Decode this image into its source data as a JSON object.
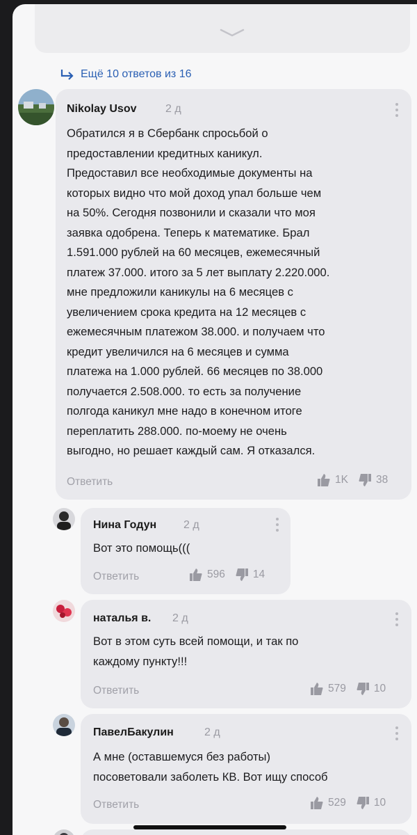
{
  "thread": {
    "more_replies": "Ещё 10 ответов из 16"
  },
  "comments": [
    {
      "author": "Nikolay Usov",
      "time": "2 д",
      "lines": [
        "Обратился я в Сбербанк спросьбой о",
        "предоставлении кредитных каникул.",
        "Предоставил все необходимые документы на",
        "которых видно что мой доход упал больше чем",
        "на 50%. Сегодня позвонили и сказали что моя",
        "заявка одобрена. Теперь к математике. Брал",
        "1.591.000 рублей на 60 месяцев, ежемесячный",
        "платеж 37.000. итого за 5 лет выплату 2.220.000.",
        "мне предложили каникулы на 6 месяцев с",
        "увеличением срока кредита на 12 месяцев с",
        "ежемесячным платежом 38.000. и получаем что",
        "кредит увеличился на 6 месяцев и сумма",
        "платежа на 1.000 рублей. 66 месяцев по 38.000",
        "получается 2.508.000. то есть за получение",
        "полгода каникул мне надо в конечном итоге",
        "переплатить 288.000. по-моему не очень",
        "выгодно, но решает каждый сам. Я отказался."
      ],
      "reply": "Ответить",
      "likes": "1K",
      "dislikes": "38"
    },
    {
      "author": "Нина Годун",
      "time": "2 д",
      "lines": [
        "Вот это помощь((("
      ],
      "reply": "Ответить",
      "likes": "596",
      "dislikes": "14"
    },
    {
      "author": "наталья в.",
      "time": "2 д",
      "lines": [
        "Вот в этом суть всей помощи, и так по",
        "каждому пункту!!!"
      ],
      "reply": "Ответить",
      "likes": "579",
      "dislikes": "10"
    },
    {
      "author": "ПавелБакулин",
      "time": "2 д",
      "lines": [
        "А мне (оставшемуся без работы)",
        "посоветовали заболеть КВ.  Вот ищу способ"
      ],
      "reply": "Ответить",
      "likes": "529",
      "dislikes": "10"
    }
  ]
}
